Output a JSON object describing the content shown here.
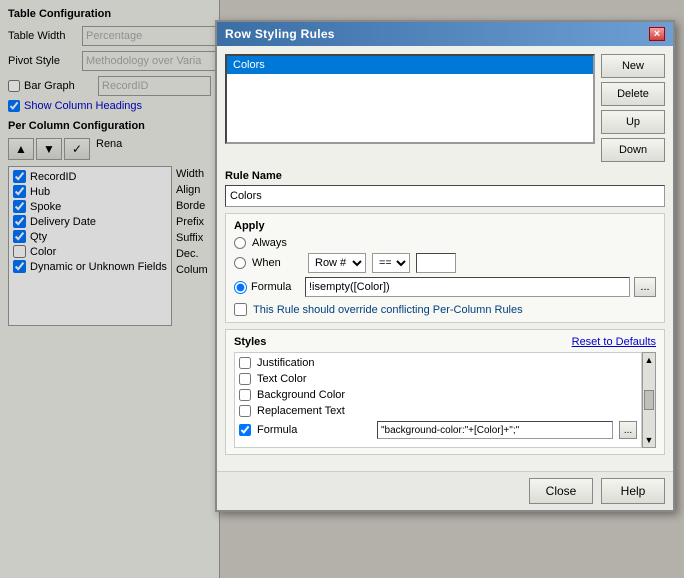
{
  "background_panel": {
    "title": "Table Configuration",
    "table_width_label": "Table Width",
    "table_width_value": "Percentage",
    "pivot_style_label": "Pivot Style",
    "pivot_style_value": "Methodology over Varia",
    "bar_graph_label": "Bar Graph",
    "bar_graph_value": "RecordID",
    "bar_graph_checked": false,
    "show_column_headings_label": "Show Column Headings",
    "show_column_headings_checked": true,
    "per_column_title": "Per Column Configuration",
    "btn_up": "↑",
    "btn_down": "↓",
    "btn_check": "✓",
    "rename_label": "Rena",
    "width_label": "Width",
    "align_label": "Align",
    "border_label": "Borde",
    "prefix_label": "Prefix",
    "suffix_label": "Suffix",
    "dec_label": "Dec.",
    "column_label": "Colum",
    "columns": [
      {
        "checked": true,
        "label": "RecordID"
      },
      {
        "checked": true,
        "label": "Hub"
      },
      {
        "checked": true,
        "label": "Spoke"
      },
      {
        "checked": true,
        "label": "Delivery Date"
      },
      {
        "checked": true,
        "label": "Qty"
      },
      {
        "checked": false,
        "label": "Color"
      },
      {
        "checked": true,
        "label": "Dynamic or Unknown Fields"
      }
    ]
  },
  "modal": {
    "title": "Row Styling Rules",
    "close_btn": "×",
    "rules_list": [
      {
        "label": "Colors",
        "selected": true
      }
    ],
    "btn_new": "New",
    "btn_delete": "Delete",
    "btn_up": "Up",
    "btn_down": "Down",
    "rule_name_label": "Rule Name",
    "rule_name_value": "Colors",
    "apply_section_title": "Apply",
    "always_label": "Always",
    "when_label": "When",
    "formula_label": "Formula",
    "when_field_options": [
      "Row #"
    ],
    "when_field_selected": "Row #",
    "when_op_options": [
      "=="
    ],
    "when_op_selected": "==",
    "when_value": "",
    "formula_value": "!isempty([Color])",
    "formula_ellipsis": "...",
    "override_label": "This Rule should override conflicting Per-Column Rules",
    "override_checked": false,
    "styles_title": "Styles",
    "reset_link": "Reset to Defaults",
    "style_rows": [
      {
        "checked": false,
        "label": "Justification",
        "value": ""
      },
      {
        "checked": false,
        "label": "Text Color",
        "value": ""
      },
      {
        "checked": false,
        "label": "Background Color",
        "value": ""
      },
      {
        "checked": false,
        "label": "Replacement Text",
        "value": ""
      },
      {
        "checked": true,
        "label": "Formula",
        "value": "\"background-color:\"+[Color]+\";\""
      }
    ],
    "btn_close": "Close",
    "btn_help": "Help",
    "apply_always_selected": false,
    "apply_when_selected": false,
    "apply_formula_selected": true
  }
}
